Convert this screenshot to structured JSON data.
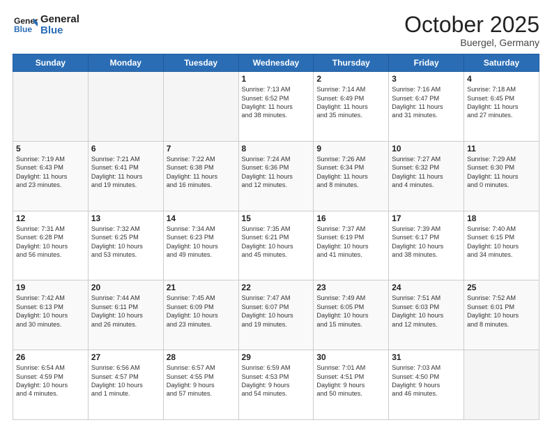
{
  "header": {
    "logo_general": "General",
    "logo_blue": "Blue",
    "month_title": "October 2025",
    "location": "Buergel, Germany"
  },
  "days_of_week": [
    "Sunday",
    "Monday",
    "Tuesday",
    "Wednesday",
    "Thursday",
    "Friday",
    "Saturday"
  ],
  "weeks": [
    [
      {
        "day": "",
        "content": ""
      },
      {
        "day": "",
        "content": ""
      },
      {
        "day": "",
        "content": ""
      },
      {
        "day": "1",
        "content": "Sunrise: 7:13 AM\nSunset: 6:52 PM\nDaylight: 11 hours\nand 38 minutes."
      },
      {
        "day": "2",
        "content": "Sunrise: 7:14 AM\nSunset: 6:49 PM\nDaylight: 11 hours\nand 35 minutes."
      },
      {
        "day": "3",
        "content": "Sunrise: 7:16 AM\nSunset: 6:47 PM\nDaylight: 11 hours\nand 31 minutes."
      },
      {
        "day": "4",
        "content": "Sunrise: 7:18 AM\nSunset: 6:45 PM\nDaylight: 11 hours\nand 27 minutes."
      }
    ],
    [
      {
        "day": "5",
        "content": "Sunrise: 7:19 AM\nSunset: 6:43 PM\nDaylight: 11 hours\nand 23 minutes."
      },
      {
        "day": "6",
        "content": "Sunrise: 7:21 AM\nSunset: 6:41 PM\nDaylight: 11 hours\nand 19 minutes."
      },
      {
        "day": "7",
        "content": "Sunrise: 7:22 AM\nSunset: 6:38 PM\nDaylight: 11 hours\nand 16 minutes."
      },
      {
        "day": "8",
        "content": "Sunrise: 7:24 AM\nSunset: 6:36 PM\nDaylight: 11 hours\nand 12 minutes."
      },
      {
        "day": "9",
        "content": "Sunrise: 7:26 AM\nSunset: 6:34 PM\nDaylight: 11 hours\nand 8 minutes."
      },
      {
        "day": "10",
        "content": "Sunrise: 7:27 AM\nSunset: 6:32 PM\nDaylight: 11 hours\nand 4 minutes."
      },
      {
        "day": "11",
        "content": "Sunrise: 7:29 AM\nSunset: 6:30 PM\nDaylight: 11 hours\nand 0 minutes."
      }
    ],
    [
      {
        "day": "12",
        "content": "Sunrise: 7:31 AM\nSunset: 6:28 PM\nDaylight: 10 hours\nand 56 minutes."
      },
      {
        "day": "13",
        "content": "Sunrise: 7:32 AM\nSunset: 6:25 PM\nDaylight: 10 hours\nand 53 minutes."
      },
      {
        "day": "14",
        "content": "Sunrise: 7:34 AM\nSunset: 6:23 PM\nDaylight: 10 hours\nand 49 minutes."
      },
      {
        "day": "15",
        "content": "Sunrise: 7:35 AM\nSunset: 6:21 PM\nDaylight: 10 hours\nand 45 minutes."
      },
      {
        "day": "16",
        "content": "Sunrise: 7:37 AM\nSunset: 6:19 PM\nDaylight: 10 hours\nand 41 minutes."
      },
      {
        "day": "17",
        "content": "Sunrise: 7:39 AM\nSunset: 6:17 PM\nDaylight: 10 hours\nand 38 minutes."
      },
      {
        "day": "18",
        "content": "Sunrise: 7:40 AM\nSunset: 6:15 PM\nDaylight: 10 hours\nand 34 minutes."
      }
    ],
    [
      {
        "day": "19",
        "content": "Sunrise: 7:42 AM\nSunset: 6:13 PM\nDaylight: 10 hours\nand 30 minutes."
      },
      {
        "day": "20",
        "content": "Sunrise: 7:44 AM\nSunset: 6:11 PM\nDaylight: 10 hours\nand 26 minutes."
      },
      {
        "day": "21",
        "content": "Sunrise: 7:45 AM\nSunset: 6:09 PM\nDaylight: 10 hours\nand 23 minutes."
      },
      {
        "day": "22",
        "content": "Sunrise: 7:47 AM\nSunset: 6:07 PM\nDaylight: 10 hours\nand 19 minutes."
      },
      {
        "day": "23",
        "content": "Sunrise: 7:49 AM\nSunset: 6:05 PM\nDaylight: 10 hours\nand 15 minutes."
      },
      {
        "day": "24",
        "content": "Sunrise: 7:51 AM\nSunset: 6:03 PM\nDaylight: 10 hours\nand 12 minutes."
      },
      {
        "day": "25",
        "content": "Sunrise: 7:52 AM\nSunset: 6:01 PM\nDaylight: 10 hours\nand 8 minutes."
      }
    ],
    [
      {
        "day": "26",
        "content": "Sunrise: 6:54 AM\nSunset: 4:59 PM\nDaylight: 10 hours\nand 4 minutes."
      },
      {
        "day": "27",
        "content": "Sunrise: 6:56 AM\nSunset: 4:57 PM\nDaylight: 10 hours\nand 1 minute."
      },
      {
        "day": "28",
        "content": "Sunrise: 6:57 AM\nSunset: 4:55 PM\nDaylight: 9 hours\nand 57 minutes."
      },
      {
        "day": "29",
        "content": "Sunrise: 6:59 AM\nSunset: 4:53 PM\nDaylight: 9 hours\nand 54 minutes."
      },
      {
        "day": "30",
        "content": "Sunrise: 7:01 AM\nSunset: 4:51 PM\nDaylight: 9 hours\nand 50 minutes."
      },
      {
        "day": "31",
        "content": "Sunrise: 7:03 AM\nSunset: 4:50 PM\nDaylight: 9 hours\nand 46 minutes."
      },
      {
        "day": "",
        "content": ""
      }
    ]
  ]
}
